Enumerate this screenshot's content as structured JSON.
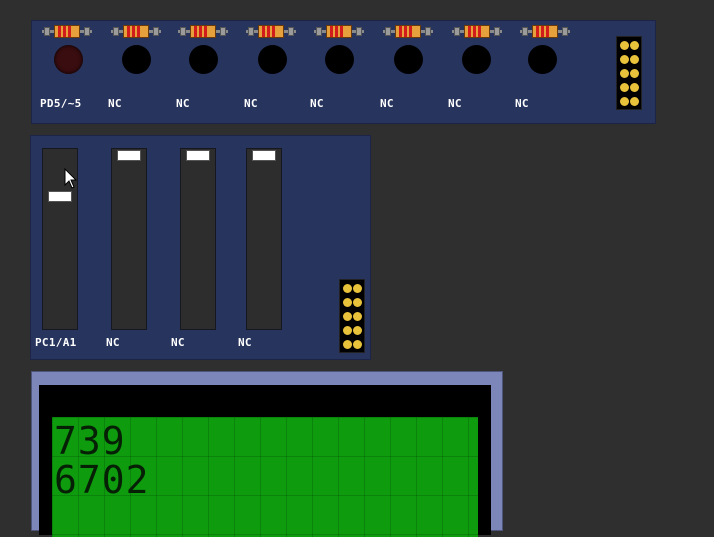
{
  "led_panel": {
    "labels": [
      "PD5/~5",
      "NC",
      "NC",
      "NC",
      "NC",
      "NC",
      "NC",
      "NC"
    ],
    "led_states": [
      "dim",
      "off",
      "off",
      "off",
      "off",
      "off",
      "off",
      "off"
    ]
  },
  "slider_panel": {
    "labels": [
      "PC1/A1",
      "NC",
      "NC",
      "NC"
    ]
  },
  "lcd": {
    "line1": "739",
    "line2": "6702"
  }
}
